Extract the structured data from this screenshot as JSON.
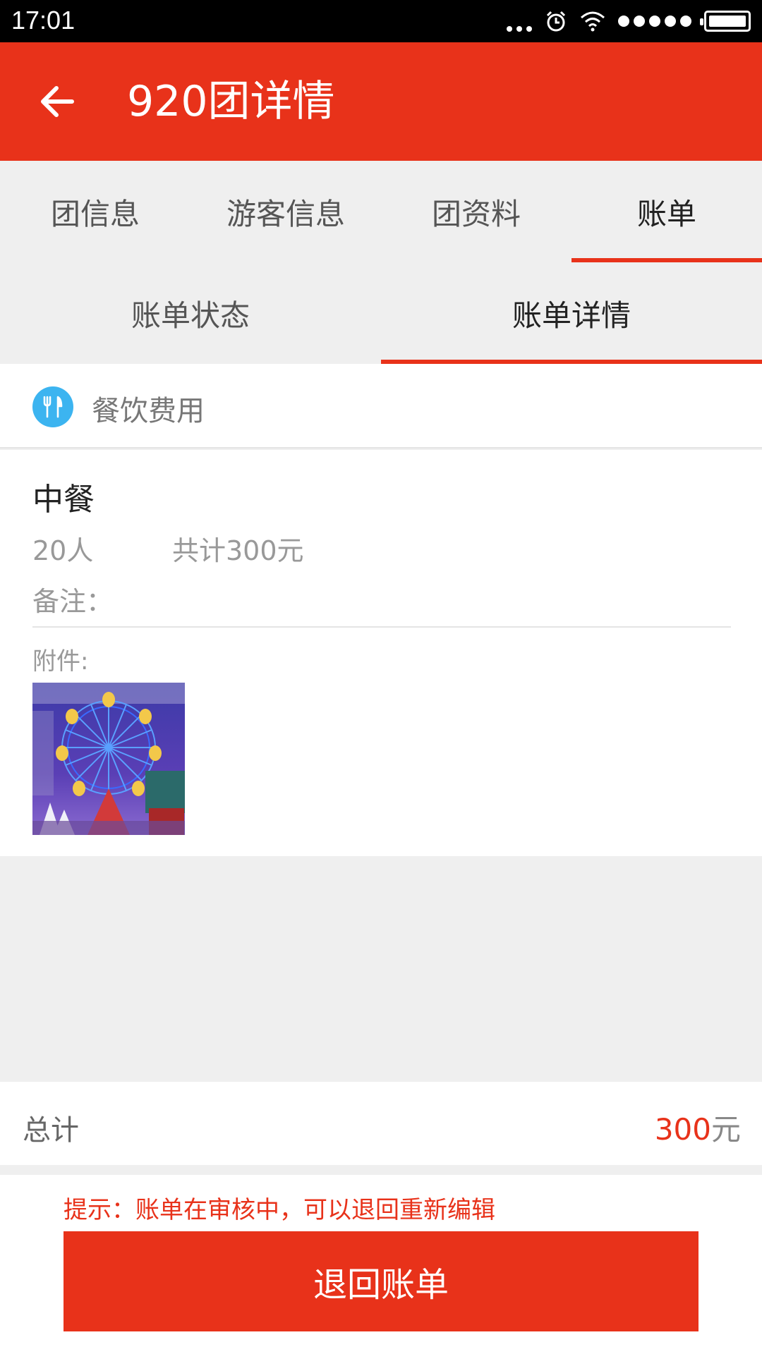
{
  "status_bar": {
    "time": "17:01"
  },
  "app_bar": {
    "title": "920团详情",
    "back_icon": "arrow-left-icon"
  },
  "main_tabs": [
    {
      "label": "团信息",
      "active": false
    },
    {
      "label": "游客信息",
      "active": false
    },
    {
      "label": "团资料",
      "active": false
    },
    {
      "label": "账单",
      "active": true
    }
  ],
  "sub_tabs": [
    {
      "label": "账单状态",
      "active": false
    },
    {
      "label": "账单详情",
      "active": true
    }
  ],
  "category": {
    "label": "餐饮费用",
    "icon": "fork-knife-icon",
    "icon_color": "#3cb4f0"
  },
  "bill_item": {
    "title": "中餐",
    "people": "20人",
    "total": "共计300元",
    "remark_label": "备注：",
    "attachment_label": "附件:"
  },
  "summary": {
    "label": "总计",
    "amount": "300",
    "unit": "元"
  },
  "footer": {
    "hint": "提示：账单在审核中，可以退回重新编辑",
    "button_label": "退回账单"
  },
  "colors": {
    "accent": "#e8321a",
    "background": "#efefef"
  }
}
